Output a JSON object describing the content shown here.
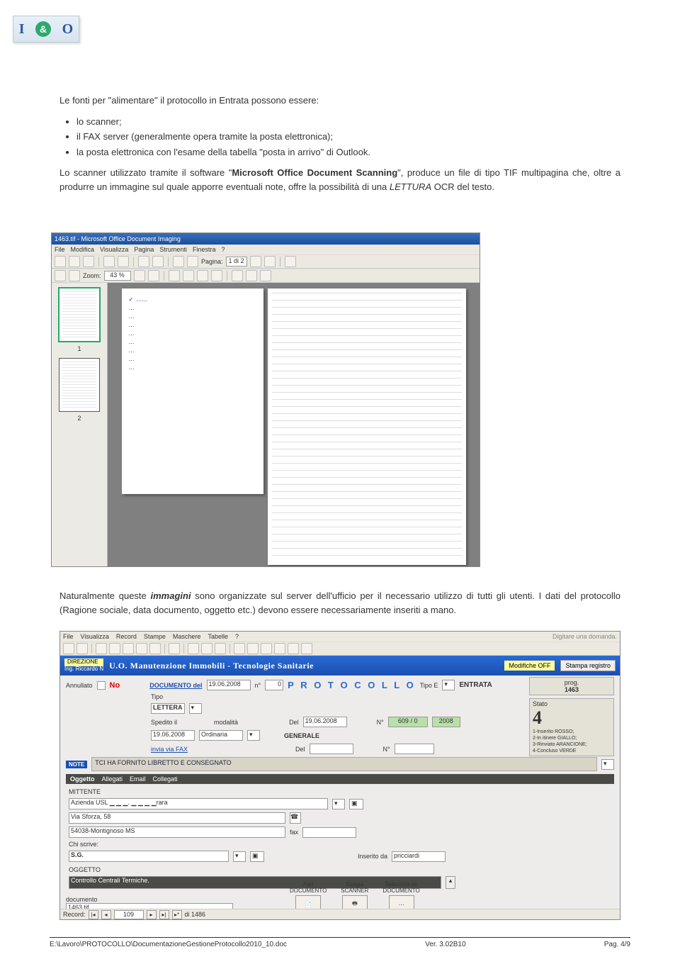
{
  "doc": {
    "p1_intro": "Le fonti per \"alimentare\" il protocollo in Entrata possono essere:",
    "bullets": [
      "lo scanner;",
      "il FAX server (generalmente opera tramite la posta elettronica);",
      "la posta elettronica con l'esame della tabella \"posta in arrivo\" di Outlook."
    ],
    "p2_a": "Lo scanner utilizzato tramite il software \"",
    "p2_b": "Microsoft Office Document Scanning",
    "p2_c": "\", produce un file di tipo TIF multipagina che, oltre a produrre un immagine sul quale apporre eventuali note, offre la possibilità di una ",
    "p2_d": "LETTURA",
    "p2_e": " OCR del testo.",
    "p3_a": "Naturalmente queste ",
    "p3_b": "immagini",
    "p3_c": " sono organizzate sul server dell'ufficio per il necessario utilizzo di tutti gli utenti. I dati del protocollo (Ragione sociale, data documento, oggetto etc.) devono essere necessariamente inseriti a mano."
  },
  "shot1": {
    "title": "1463.tif - Microsoft Office Document Imaging",
    "menu": [
      "File",
      "Modifica",
      "Visualizza",
      "Pagina",
      "Strumenti",
      "Finestra",
      "?"
    ],
    "page_label": "Pagina:",
    "page_value": "1 di 2",
    "zoom_label": "Zoom:",
    "zoom_value": "43 %",
    "thumb1": "1",
    "thumb2": "2"
  },
  "shot2": {
    "menu": [
      "File",
      "Visualizza",
      "Record",
      "Stampe",
      "Maschere",
      "Tabelle",
      "?"
    ],
    "help_hint": "Digitare una domanda.",
    "direzione": "DIREZIONE",
    "ing": "Ing. Riccardo N",
    "uo_title": "U.O. Manutenzione Immobili - Tecnologie Sanitarie",
    "modifiche": "Modifiche OFF",
    "stampa": "Stampa registro",
    "annullato": "Annullato",
    "no": "No",
    "documento_del": "DOCUMENTO del",
    "doc_date": "19.06.2008",
    "doc_n": "n°",
    "doc_n_val": "0",
    "tipo": "Tipo",
    "tipo_val": "LETTERA",
    "spedito": "Spedito il",
    "sped_date": "19.06.2008",
    "modalita": "modalità",
    "modalita_val": "Ordinaria",
    "invia_fax": "invia via FAX",
    "protocollo": "P R O T O C O L L O",
    "tipo_e": "Tipo E",
    "entrata": "ENTRATA",
    "del": "Del",
    "del_date": "19.06.2008",
    "num": "N°",
    "num_val": "609 / 0",
    "anno": "2008",
    "generale": "GENERALE",
    "del2": "Del",
    "num2": "N°",
    "note_lbl": "NOTE",
    "note_val": "TCI HA FORNITO LIBRETTO E CONSEGNATO",
    "tabs": [
      "Oggetto",
      "Allegati",
      "Email",
      "Collegati"
    ],
    "mittente": "MITTENTE",
    "mittente_val": "Azienda USL ▁ ▁ ▁.  ▁ ▁ ▁ ▁rara",
    "via": "Via Sforza, 58",
    "cap": "54038-Montignoso MS",
    "chi": "Chi scrive:",
    "chi_val": "S.G.",
    "fax": "fax",
    "inserito": "Inserito da",
    "inserito_val": "pricciardi",
    "oggetto": "OGGETTO",
    "oggetto_val": "Controllo Centrali Termiche.",
    "prog_lbl": "prog.",
    "prog_val": "1463",
    "stato_lbl": "Stato",
    "stato_val": "4",
    "legend": [
      "1-Inserito ROSSO;",
      "2-In itinere GIALLO;",
      "3-Rinviato ARANCIONE;",
      "4-Concluso VERDE"
    ],
    "documento_lbl": "documento",
    "documento_val": "1463.tif",
    "act1": "Apri\nDOCUMENTO",
    "act2": "Esegui\nSCANNER",
    "act3": "Seleziona un\nDOCUMENTO",
    "record_lbl": "Record:",
    "record_val": "109",
    "record_tot": "di 1486"
  },
  "footer": {
    "path": "E:\\Lavoro\\PROTOCOLLO\\DocumentazioneGestioneProtocollo2010_10.doc",
    "ver": "Ver. 3.02B10",
    "page": "Pag. 4/9"
  }
}
